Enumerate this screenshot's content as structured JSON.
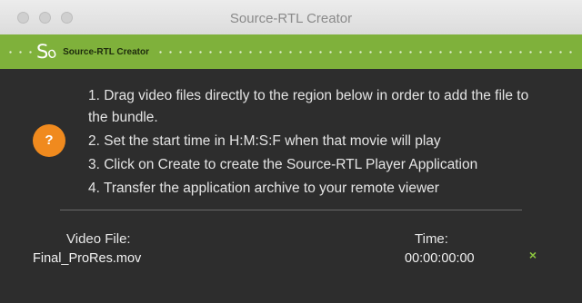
{
  "window": {
    "title": "Source-RTL Creator"
  },
  "banner": {
    "logo_mark": "S",
    "logo_mark_o": "o",
    "app_name": "Source-RTL Creator",
    "accent_color": "#7fb13b"
  },
  "help": {
    "label": "?",
    "color": "#f08a1e"
  },
  "instructions": [
    "1. Drag video files directly to the region below in order to add the file to the bundle.",
    "2. Set the start time in H:M:S:F when that movie will play",
    "3. Click on Create to create the Source-RTL Player Application",
    "4. Transfer the application archive to your remote viewer"
  ],
  "table": {
    "headers": {
      "video_file": "Video File:",
      "time": "Time:"
    },
    "rows": [
      {
        "file": "Final_ProRes.mov",
        "time": "00:00:00:00",
        "remove": "×"
      }
    ]
  }
}
